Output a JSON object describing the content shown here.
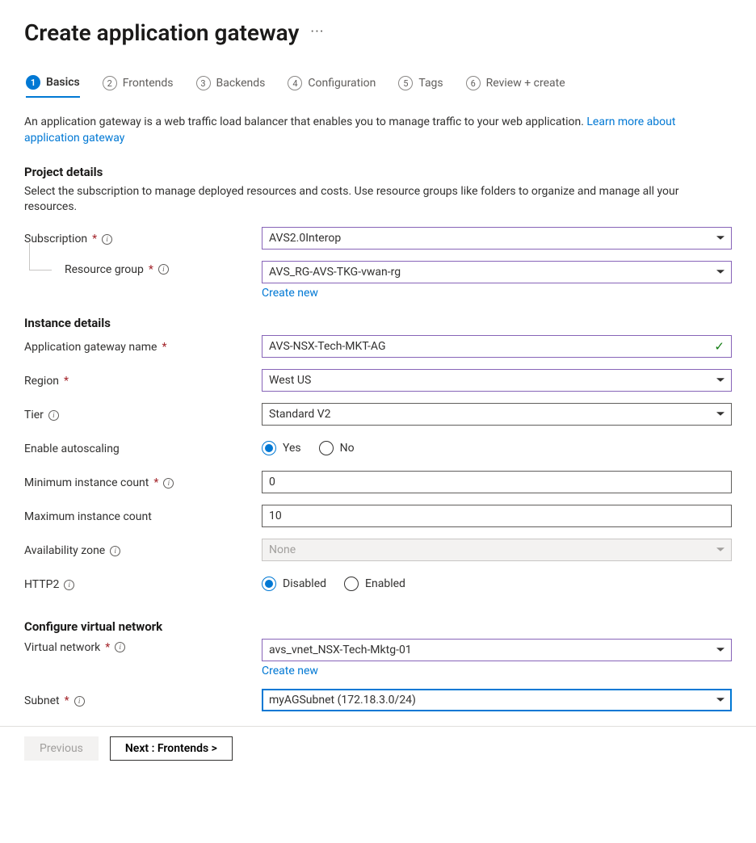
{
  "title": "Create application gateway",
  "tabs": [
    {
      "num": "1",
      "label": "Basics"
    },
    {
      "num": "2",
      "label": "Frontends"
    },
    {
      "num": "3",
      "label": "Backends"
    },
    {
      "num": "4",
      "label": "Configuration"
    },
    {
      "num": "5",
      "label": "Tags"
    },
    {
      "num": "6",
      "label": "Review + create"
    }
  ],
  "intro": {
    "text": "An application gateway is a web traffic load balancer that enables you to manage traffic to your web application.  ",
    "link": "Learn more about application gateway"
  },
  "project": {
    "heading": "Project details",
    "desc": "Select the subscription to manage deployed resources and costs. Use resource groups like folders to organize and manage all your resources.",
    "subscription_label": "Subscription",
    "subscription_value": "AVS2.0Interop",
    "resource_group_label": "Resource group",
    "resource_group_value": "AVS_RG-AVS-TKG-vwan-rg",
    "create_new": "Create new"
  },
  "instance": {
    "heading": "Instance details",
    "name_label": "Application gateway name",
    "name_value": "AVS-NSX-Tech-MKT-AG",
    "region_label": "Region",
    "region_value": "West US",
    "tier_label": "Tier",
    "tier_value": "Standard V2",
    "autoscale_label": "Enable autoscaling",
    "autoscale_yes": "Yes",
    "autoscale_no": "No",
    "min_label": "Minimum instance count",
    "min_value": "0",
    "max_label": "Maximum instance count",
    "max_value": "10",
    "zone_label": "Availability zone",
    "zone_value": "None",
    "http2_label": "HTTP2",
    "http2_disabled": "Disabled",
    "http2_enabled": "Enabled"
  },
  "vnet": {
    "heading": "Configure virtual network",
    "vnet_label": "Virtual network",
    "vnet_value": "avs_vnet_NSX-Tech-Mktg-01",
    "create_new": "Create new",
    "subnet_label": "Subnet",
    "subnet_value": "myAGSubnet (172.18.3.0/24)"
  },
  "footer": {
    "previous": "Previous",
    "next": "Next : Frontends >"
  }
}
